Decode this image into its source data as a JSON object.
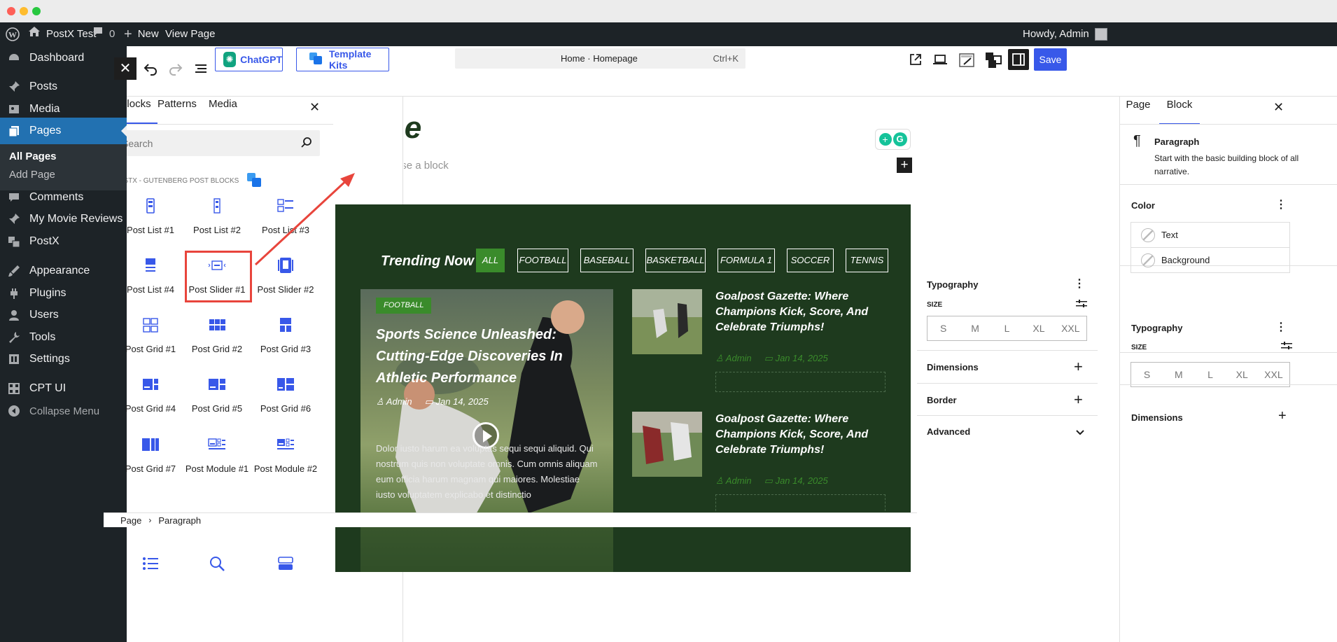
{
  "admin_bar": {
    "site_name": "PostX Test",
    "comments_count": "0",
    "new_label": "New",
    "view_page": "View Page",
    "howdy": "Howdy, Admin"
  },
  "sidebar": {
    "items": [
      {
        "label": "Dashboard",
        "icon": "dashboard-icon"
      },
      {
        "label": "Posts",
        "icon": "pin-icon"
      },
      {
        "label": "Media",
        "icon": "media-icon"
      },
      {
        "label": "Pages",
        "icon": "pages-icon"
      },
      {
        "label": "Comments",
        "icon": "comment-icon"
      },
      {
        "label": "My Movie Reviews",
        "icon": "pin-icon"
      },
      {
        "label": "PostX",
        "icon": "postx-icon"
      },
      {
        "label": "Appearance",
        "icon": "brush-icon"
      },
      {
        "label": "Plugins",
        "icon": "plug-icon"
      },
      {
        "label": "Users",
        "icon": "user-icon"
      },
      {
        "label": "Tools",
        "icon": "wrench-icon"
      },
      {
        "label": "Settings",
        "icon": "settings-icon"
      },
      {
        "label": "CPT UI",
        "icon": "cpt-icon"
      },
      {
        "label": "Collapse Menu",
        "icon": "collapse-icon"
      }
    ],
    "submenu": [
      "All Pages",
      "Add Page"
    ]
  },
  "toolbar": {
    "chatgpt": "ChatGPT",
    "template_kits": "Template Kits",
    "doc_title": "Home · Homepage",
    "shortcut": "Ctrl+K",
    "save": "Save"
  },
  "inserter": {
    "tabs": [
      "Blocks",
      "Patterns",
      "Media"
    ],
    "search_placeholder": "Search",
    "category": "POSTX - GUTENBERG POST BLOCKS",
    "blocks": [
      "Post List #1",
      "Post List #2",
      "Post List #3",
      "Post List #4",
      "Post Slider #1",
      "Post Slider #2",
      "Post Grid #1",
      "Post Grid #2",
      "Post Grid #3",
      "Post Grid #4",
      "Post Grid #5",
      "Post Grid #6",
      "Post Grid #7",
      "Post Module #1",
      "Post Module #2"
    ]
  },
  "canvas": {
    "page_title": "Home",
    "placeholder": "Type / to choose a block",
    "trending": "Trending Now",
    "filters": [
      "ALL",
      "FOOTBALL",
      "BASEBALL",
      "BASKETBALL",
      "FORMULA 1",
      "SOCCER",
      "TENNIS"
    ],
    "main_post": {
      "badge": "FOOTBALL",
      "title": "Sports Science Unleashed: Cutting-Edge Discoveries In Athletic Performance",
      "author": "Admin",
      "date": "Jan 14, 2025",
      "excerpt": "Dolor iusto harum ea voluptas sequi sequi aliquid. Qui nostrum quis non voluptate omnis. Cum omnis aliquam eum officia harum magnam qui maiores. Molestiae iusto voluptatem explicabo et distinctio"
    },
    "side_posts": [
      {
        "title": "Goalpost Gazette: Where Champions Kick, Score, And Celebrate Triumphs!",
        "author": "Admin",
        "date": "Jan 14, 2025"
      },
      {
        "title": "Goalpost Gazette: Where Champions Kick, Score, And Celebrate Triumphs!",
        "author": "Admin",
        "date": "Jan 14, 2025"
      }
    ]
  },
  "settings": {
    "tabs": [
      "Page",
      "Block"
    ],
    "block_name": "Paragraph",
    "block_desc": "Start with the basic building block of all narrative.",
    "color_label": "Color",
    "color_items": [
      "Text",
      "Background"
    ],
    "typography": "Typography",
    "size_label": "SIZE",
    "sizes": [
      "S",
      "M",
      "L",
      "XL",
      "XXL"
    ],
    "dimensions": "Dimensions",
    "border": "Border",
    "advanced": "Advanced"
  },
  "breadcrumb": [
    "Page",
    "Paragraph"
  ],
  "colors": {
    "accent": "#3858e9",
    "dark_green": "#1e3a1e",
    "green": "#3a8b2b",
    "red_highlight": "#e8453c"
  }
}
